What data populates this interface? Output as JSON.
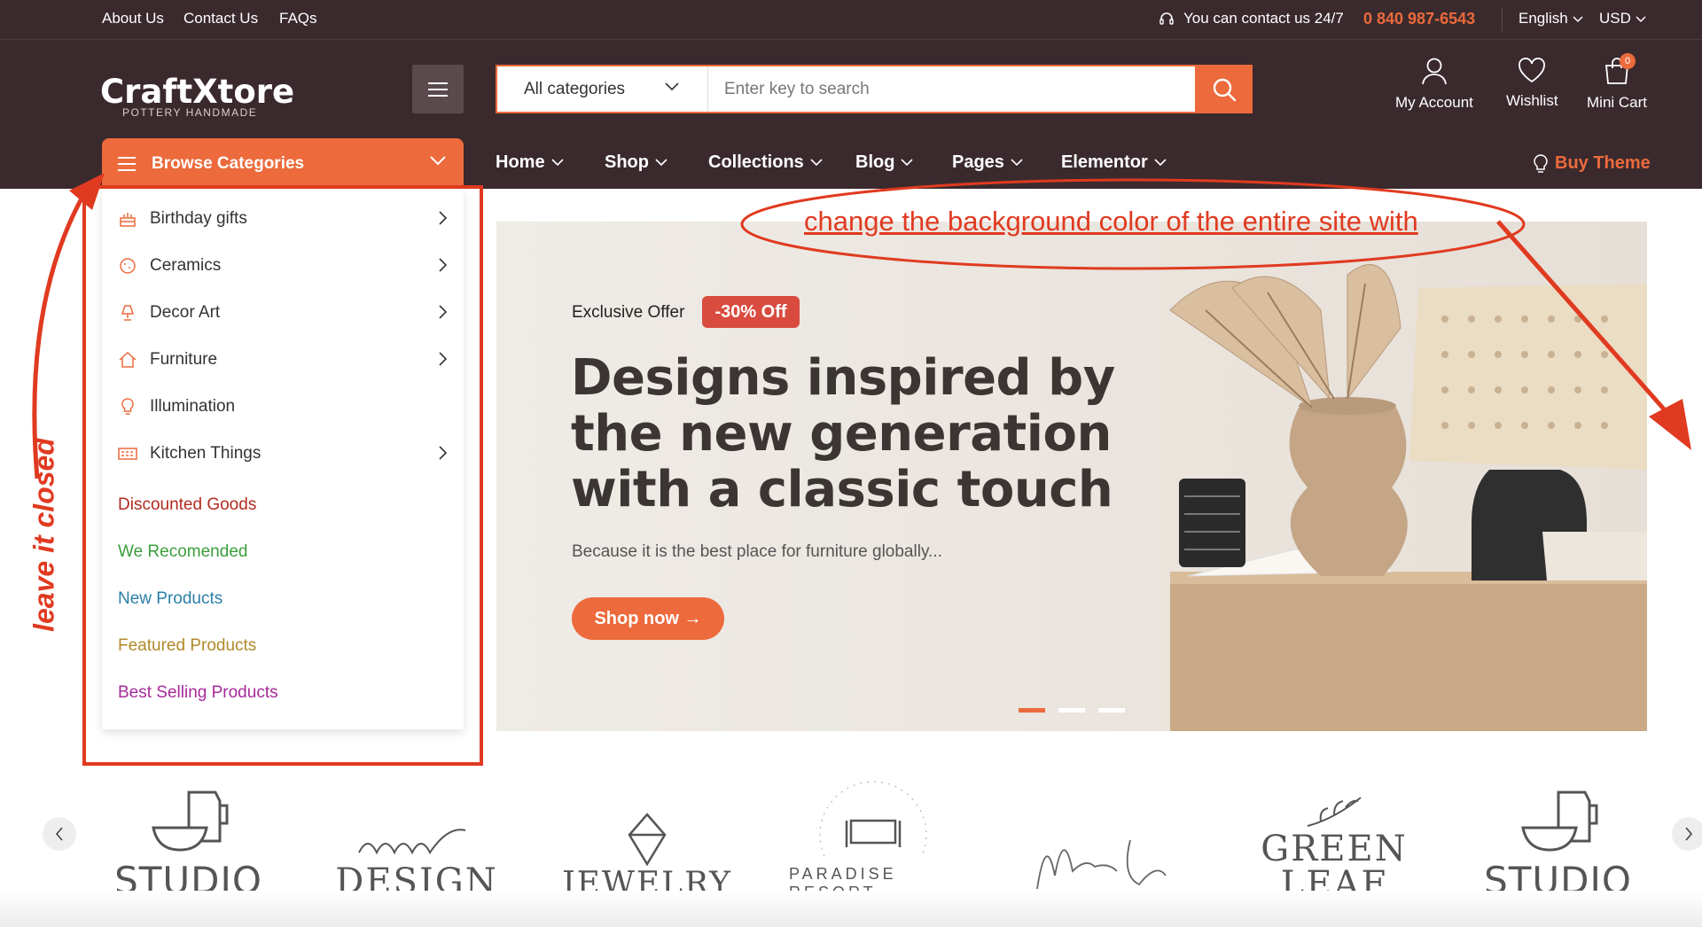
{
  "topbar": {
    "links": [
      "About Us",
      "Contact Us",
      "FAQs"
    ],
    "contact_text": "You can contact us 24/7",
    "phone": "0 840 987-6543",
    "language": "English",
    "currency": "USD"
  },
  "logo": {
    "text": "CraftXtore",
    "tagline": "POTTERY HANDMADE"
  },
  "search": {
    "category": "All categories",
    "placeholder": "Enter key to search"
  },
  "header_actions": {
    "account": "My Account",
    "wishlist": "Wishlist",
    "cart": "Mini Cart",
    "cart_count": "0"
  },
  "browse": {
    "label": "Browse Categories"
  },
  "nav": {
    "items": [
      "Home",
      "Shop",
      "Collections",
      "Blog",
      "Pages",
      "Elementor"
    ],
    "buy_theme": "Buy Theme"
  },
  "categories": [
    {
      "label": "Birthday gifts",
      "icon": "cake-icon",
      "submenu": true
    },
    {
      "label": "Ceramics",
      "icon": "ceramic-icon",
      "submenu": true
    },
    {
      "label": "Decor Art",
      "icon": "lamp-icon",
      "submenu": true
    },
    {
      "label": "Furniture",
      "icon": "home-icon",
      "submenu": true
    },
    {
      "label": "Illumination",
      "icon": "bulb-icon",
      "submenu": false
    },
    {
      "label": "Kitchen Things",
      "icon": "kitchen-icon",
      "submenu": true
    }
  ],
  "category_links": [
    {
      "label": "Discounted Goods",
      "color": "#b32a1f"
    },
    {
      "label": "We Recomended",
      "color": "#3a9e3a"
    },
    {
      "label": "New Products",
      "color": "#2b7fa8"
    },
    {
      "label": "Featured Products",
      "color": "#b08a2a"
    },
    {
      "label": "Best Selling Products",
      "color": "#a62a9a"
    }
  ],
  "hero": {
    "offer_label": "Exclusive Offer",
    "offer_badge": "-30% Off",
    "title": "Designs inspired by the new generation with a classic touch",
    "subtitle": "Because it is the best place for furniture globally...",
    "cta": "Shop now →"
  },
  "annotations": {
    "top_note": "change the background color of the entire site with",
    "side_note": "leave it closed"
  },
  "brands": [
    "STUDIO",
    "DESIGN",
    "JEWELRY",
    "PARADISE RESORT",
    "GREEN LEAF",
    "STUDIO"
  ],
  "colors": {
    "accent": "#ec6a3c",
    "header_bg": "#3a2a2d",
    "annotation": "#e03a20"
  }
}
